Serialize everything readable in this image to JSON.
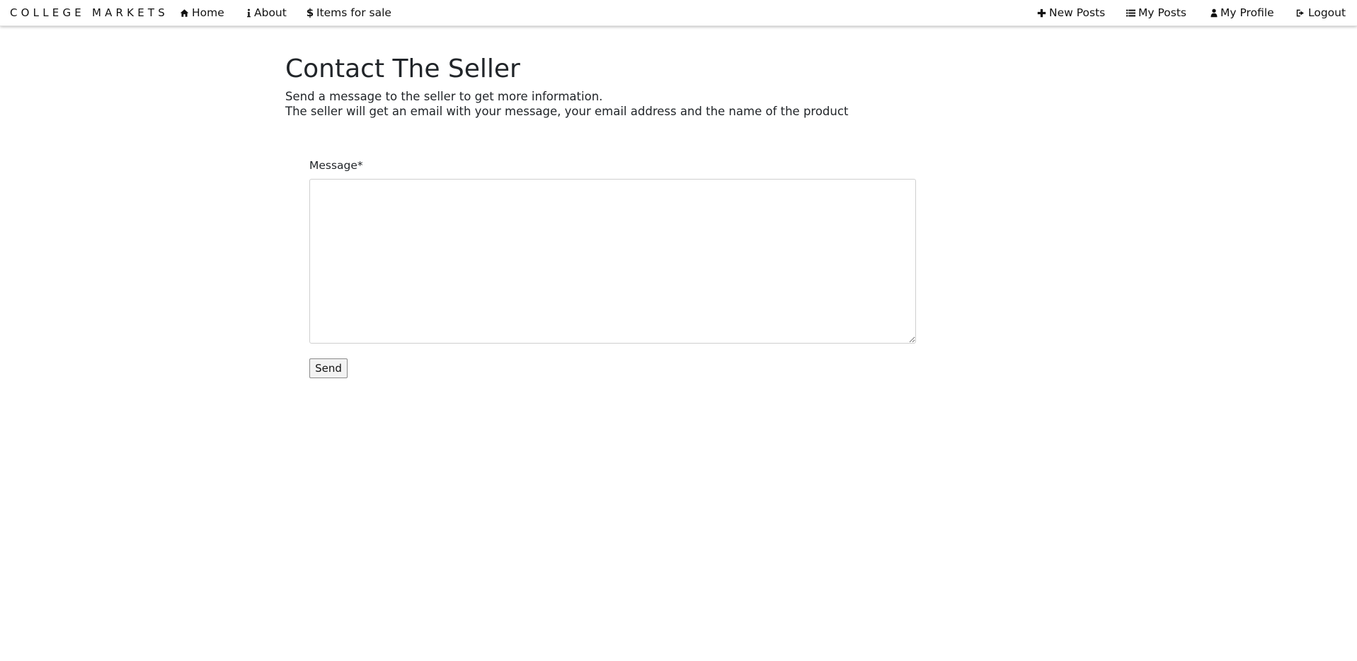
{
  "brand": "COLLEGE MARKETS",
  "nav": {
    "left": [
      {
        "label": "Home",
        "icon": "home-icon"
      },
      {
        "label": "About",
        "icon": "info-icon"
      },
      {
        "label": "Items for sale",
        "icon": "dollar-icon"
      }
    ],
    "right": [
      {
        "label": "New Posts",
        "icon": "plus-icon"
      },
      {
        "label": "My Posts",
        "icon": "list-icon"
      },
      {
        "label": "My Profile",
        "icon": "user-icon"
      },
      {
        "label": "Logout",
        "icon": "logout-icon"
      }
    ]
  },
  "main": {
    "title": "Contact The Seller",
    "subtitle_line1": "Send a message to the seller to get more information.",
    "subtitle_line2": "The seller will get an email with your message, your email address and the name of the product"
  },
  "form": {
    "message_label": "Message*",
    "message_value": "",
    "send_label": "Send"
  }
}
